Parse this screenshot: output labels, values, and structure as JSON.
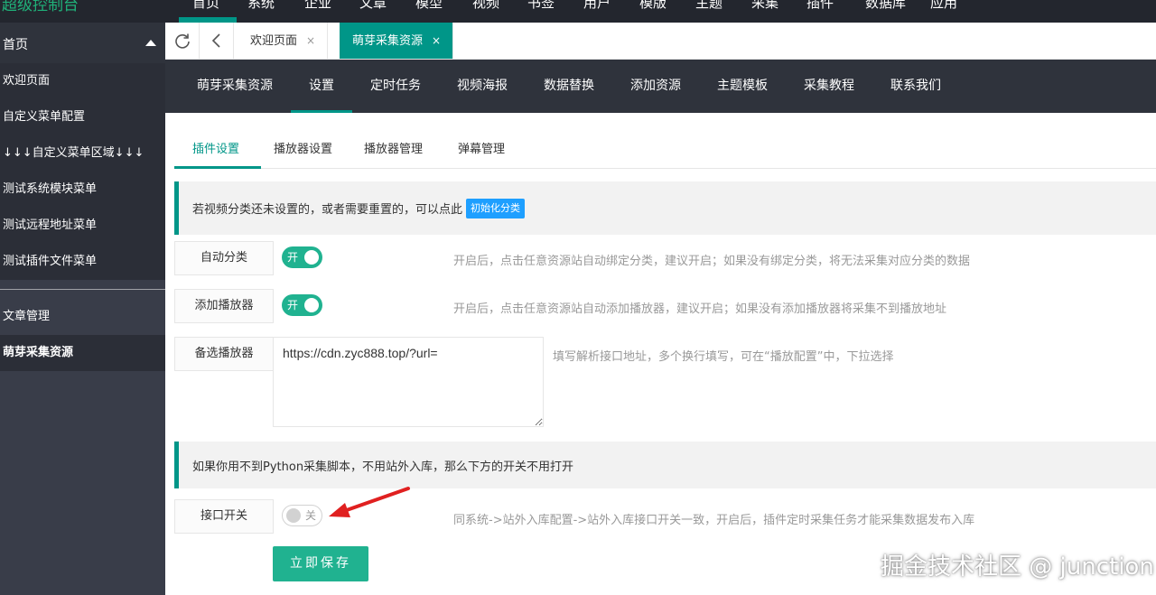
{
  "topbar": {
    "brand": "超级控制台",
    "nav": [
      "首页",
      "系统",
      "企业",
      "文章",
      "模型",
      "视频",
      "书签",
      "用户",
      "模版",
      "主题",
      "采集",
      "插件",
      "数据库",
      "应用"
    ]
  },
  "sidebar": {
    "header": "首页",
    "items": [
      "欢迎页面",
      "自定义菜单配置",
      "↓↓↓自定义菜单区域↓↓↓",
      "测试系统模块菜单",
      "测试远程地址菜单",
      "测试插件文件菜单"
    ],
    "items2": [
      "文章管理",
      "萌芽采集资源"
    ]
  },
  "tabstrip": {
    "tabs": [
      {
        "label": "欢迎页面",
        "close": "×"
      },
      {
        "label": "萌芽采集资源",
        "close": "×"
      }
    ]
  },
  "plugnav": {
    "items": [
      "萌芽采集资源",
      "设置",
      "定时任务",
      "视频海报",
      "数据替换",
      "添加资源",
      "主题模板",
      "采集教程",
      "联系我们"
    ]
  },
  "subtabs": {
    "items": [
      "插件设置",
      "播放器设置",
      "播放器管理",
      "弹幕管理"
    ]
  },
  "notice1": {
    "text": "若视频分类还未设置的，或者需要重置的，可以点此",
    "button": "初始化分类"
  },
  "rows": {
    "auto_category": {
      "label": "自动分类",
      "state": "开",
      "hint": "开启后，点击任意资源站自动绑定分类，建议开启；如果没有绑定分类，将无法采集对应分类的数据"
    },
    "add_player": {
      "label": "添加播放器",
      "state": "开",
      "hint": "开启后，点击任意资源站自动添加播放器，建议开启；如果没有添加播放器将采集不到播放地址"
    },
    "backup_player": {
      "label": "备选播放器",
      "value": "https://cdn.zyc888.top/?url=",
      "hint": "填写解析接口地址，多个换行填写，可在“播放配置”中，下拉选择"
    },
    "api_switch": {
      "label": "接口开关",
      "state": "关",
      "hint": "同系统->站外入库配置->站外入库接口开关一致，开启后，插件定时采集任务才能采集数据发布入库"
    }
  },
  "notice2": {
    "text": "如果你用不到Python采集脚本，不用站外入库，那么下方的开关不用打开"
  },
  "save_button": "立即保存",
  "watermark": "掘金技术社区 @ junction",
  "colors": {
    "accent": "#009688",
    "switch_on": "#20b290",
    "init_button": "#1e9fff",
    "arrow": "#e02020"
  }
}
